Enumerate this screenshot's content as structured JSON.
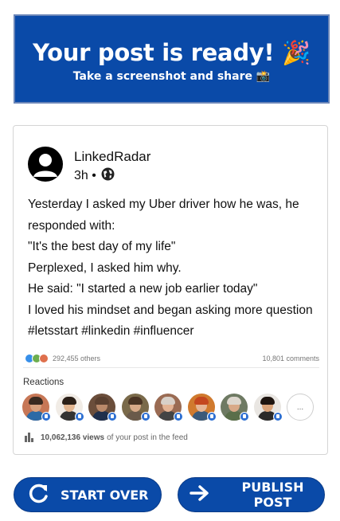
{
  "banner": {
    "title": "Your post is ready! 🎉",
    "subtitle": "Take a screenshot and share 📸"
  },
  "post": {
    "author": "LinkedRadar",
    "time": "3h •",
    "lines": [
      "Yesterday I asked my Uber driver how he was, he",
      "responded with:",
      "\"It's the best day of my life\"",
      "Perplexed, I asked him why.",
      "He said: \"I started a new job earlier today\"",
      "I loved his mindset and began asking more question",
      "#letsstart #linkedin #influencer"
    ],
    "reaction_count": "292,455 others",
    "comments": "10,801 comments",
    "reactions_label": "Reactions",
    "more_label": "...",
    "views_count": "10,062,136 views",
    "views_suffix": "of your post in the feed"
  },
  "faces": [
    {
      "bg": "#c77756",
      "skin": "#d9a27f",
      "hair": "#3a2a20",
      "shirt": "#2c6aa6"
    },
    {
      "bg": "#f1ece6",
      "skin": "#e2b590",
      "hair": "#2b2018",
      "shirt": "#333333"
    },
    {
      "bg": "#6b4e3b",
      "skin": "#b9896a",
      "hair": "#5a4030",
      "shirt": "#1f2f4c"
    },
    {
      "bg": "#7a6a4a",
      "skin": "#d7a988",
      "hair": "#4a3424",
      "shirt": "#6a5a4a"
    },
    {
      "bg": "#9a6b53",
      "skin": "#e3b394",
      "hair": "#d8d0c8",
      "shirt": "#444444"
    },
    {
      "bg": "#d07a2e",
      "skin": "#e6b594",
      "hair": "#c4471f",
      "shirt": "#3b5a7a"
    },
    {
      "bg": "#6e7a63",
      "skin": "#d8a988",
      "hair": "#ddd7ce",
      "shirt": "#5a6e4a"
    },
    {
      "bg": "#e9e6e2",
      "skin": "#d9a37a",
      "hair": "#1e1510",
      "shirt": "#2a2a2a"
    }
  ],
  "buttons": {
    "start_over": "START OVER",
    "publish": "PUBLISH POST"
  },
  "colors": {
    "brand": "#0a4aa8",
    "reaction_like": "#378fe9",
    "reaction_celebrate": "#6dae4f",
    "reaction_love": "#df704d"
  },
  "icons": [
    "globe-icon",
    "refresh-icon",
    "arrow-right-icon",
    "bar-chart-icon",
    "like-badge-icon"
  ]
}
